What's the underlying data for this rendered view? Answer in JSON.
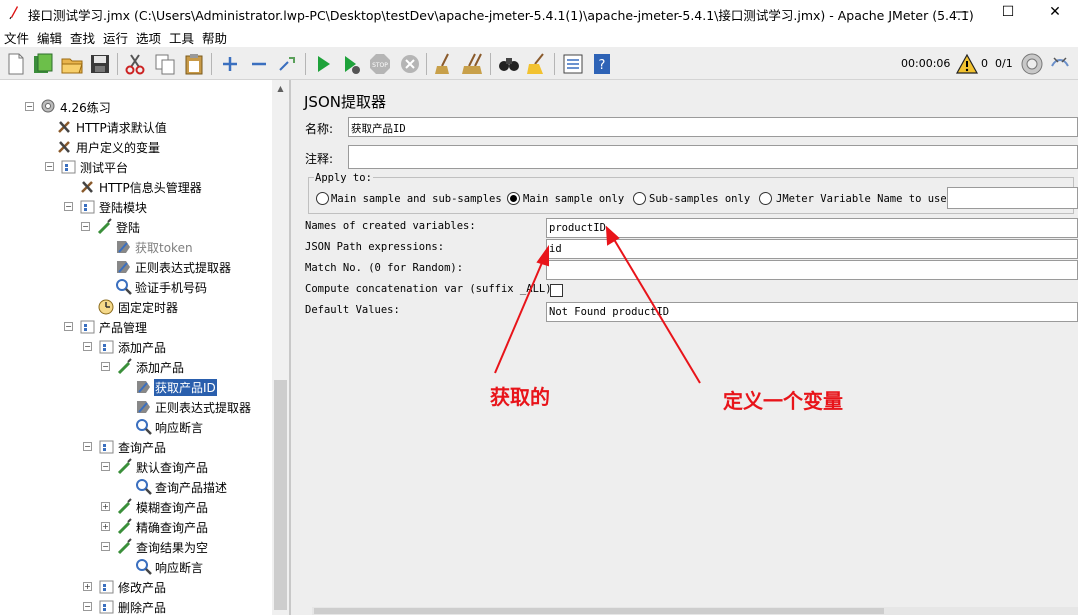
{
  "window": {
    "title": "接口测试学习.jmx (C:\\Users\\Administrator.lwp-PC\\Desktop\\testDev\\apache-jmeter-5.4.1(1)\\apache-jmeter-5.4.1\\接口测试学习.jmx) - Apache JMeter (5.4.1)",
    "minimize": "—",
    "maximize": "☐",
    "close": "✕"
  },
  "menu": [
    "文件",
    "编辑",
    "查找",
    "运行",
    "选项",
    "工具",
    "帮助"
  ],
  "toolbar": {
    "icons": [
      "new-icon",
      "templates-icon",
      "open-icon",
      "save-icon",
      "cut-icon",
      "copy-icon",
      "paste-icon",
      "expand-icon",
      "collapse-icon",
      "toggle-icon",
      "start-icon",
      "start-no-pause-icon",
      "stop-icon",
      "shutdown-icon",
      "clear-icon",
      "clear-all-icon",
      "search-icon",
      "reset-search-icon",
      "function-helper-icon",
      "help-icon"
    ],
    "timer": "00:00:06",
    "warnings": "0",
    "threads": "0/1"
  },
  "tree": [
    {
      "label": "4.26练习",
      "icon": "gear-icon"
    },
    {
      "label": "HTTP请求默认值",
      "icon": "config-icon"
    },
    {
      "label": "用户定义的变量",
      "icon": "config-icon"
    },
    {
      "label": "测试平台",
      "icon": "controller-icon"
    },
    {
      "label": "HTTP信息头管理器",
      "icon": "config-icon"
    },
    {
      "label": "登陆模块",
      "icon": "controller-icon"
    },
    {
      "label": "登陆",
      "icon": "sampler-icon"
    },
    {
      "label": "获取token",
      "icon": "extractor-icon"
    },
    {
      "label": "正则表达式提取器",
      "icon": "extractor-icon"
    },
    {
      "label": "验证手机号码",
      "icon": "assertion-icon"
    },
    {
      "label": "固定定时器",
      "icon": "timer-icon"
    },
    {
      "label": "产品管理",
      "icon": "controller-icon"
    },
    {
      "label": "添加产品",
      "icon": "controller-icon"
    },
    {
      "label": "添加产品",
      "icon": "sampler-icon"
    },
    {
      "label": "获取产品ID",
      "icon": "extractor-icon"
    },
    {
      "label": "正则表达式提取器",
      "icon": "extractor-icon"
    },
    {
      "label": "响应断言",
      "icon": "assertion-icon"
    },
    {
      "label": "查询产品",
      "icon": "controller-icon"
    },
    {
      "label": "默认查询产品",
      "icon": "sampler-icon"
    },
    {
      "label": "查询产品描述",
      "icon": "assertion-icon"
    },
    {
      "label": "模糊查询产品",
      "icon": "sampler-icon"
    },
    {
      "label": "精确查询产品",
      "icon": "sampler-icon"
    },
    {
      "label": "查询结果为空",
      "icon": "sampler-icon"
    },
    {
      "label": "响应断言",
      "icon": "assertion-icon"
    },
    {
      "label": "修改产品",
      "icon": "controller-icon"
    },
    {
      "label": "删除产品",
      "icon": "controller-icon"
    },
    {
      "label": "删除产品",
      "icon": "sampler-icon"
    }
  ],
  "panel": {
    "title": "JSON提取器",
    "name_label": "名称:",
    "name_value": "获取产品ID",
    "comment_label": "注释:",
    "comment_value": "",
    "apply_to": {
      "legend": "Apply to:",
      "options": [
        "Main sample and sub-samples",
        "Main sample only",
        "Sub-samples only",
        "JMeter Variable Name to use"
      ],
      "selected": "Main sample only",
      "variable_name": ""
    },
    "rows": [
      {
        "label": "Names of created variables:",
        "value": "productID"
      },
      {
        "label": "JSON Path expressions:",
        "value": "id"
      },
      {
        "label": "Match No. (0 for Random):",
        "value": ""
      },
      {
        "label": "Compute concatenation var (suffix _ALL):",
        "value": ""
      },
      {
        "label": "Default Values:",
        "value": "Not Found productID"
      }
    ],
    "concat_checked": false
  },
  "annotations": {
    "left": "获取的",
    "right": "定义一个变量",
    "color": "#e8141a"
  }
}
